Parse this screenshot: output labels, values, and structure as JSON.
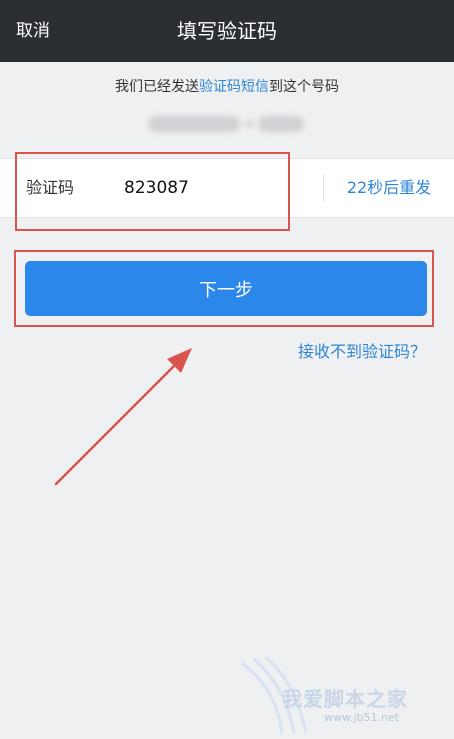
{
  "header": {
    "cancel_label": "取消",
    "title": "填写验证码"
  },
  "notice": {
    "prefix": "我们已经发送",
    "link": "验证码短信",
    "suffix": "到这个号码"
  },
  "code_field": {
    "label": "验证码",
    "value": "823087",
    "resend_label": "22秒后重发"
  },
  "next_button_label": "下一步",
  "help_link_label": "接收不到验证码？",
  "watermark": {
    "text": "我爱脚本之家",
    "url": "www.jb51.net"
  },
  "colors": {
    "header_bg": "#2b2f33",
    "accent": "#2b88ea",
    "link": "#2f86d6",
    "annotation": "#d9534f"
  }
}
